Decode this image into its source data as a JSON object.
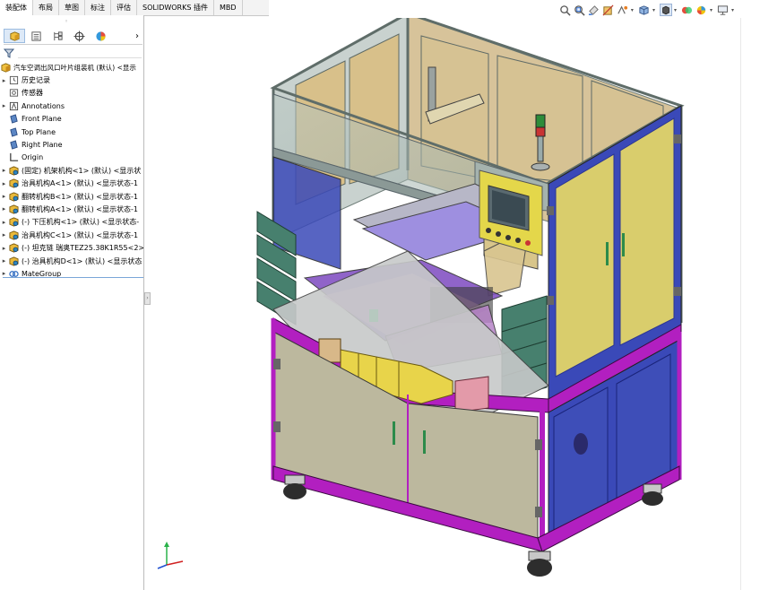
{
  "command_tabs": [
    "装配体",
    "布局",
    "草图",
    "标注",
    "评估",
    "SOLIDWORKS 插件",
    "MBD"
  ],
  "active_tab_index": 0,
  "heads_up_icons": [
    "zoom-to-fit-icon",
    "zoom-area-icon",
    "previous-view-icon",
    "section-view-icon",
    "dynamic-annotation-icon",
    "view-orientation-icon",
    "display-style-icon",
    "hide-show-icon",
    "edit-appearance-icon",
    "apply-scene-icon",
    "view-settings-icon"
  ],
  "panel_tabs": [
    "feature-manager-icon",
    "property-manager-icon",
    "configuration-manager-icon",
    "dimxpert-icon",
    "display-manager-icon"
  ],
  "tree": [
    {
      "label": "汽车空调出风口叶片组装机 (默认) <显示",
      "icon": "assembly",
      "expand": "",
      "root": true
    },
    {
      "label": "历史记录",
      "icon": "history",
      "expand": "▸"
    },
    {
      "label": "传感器",
      "icon": "sensor",
      "expand": ""
    },
    {
      "label": "Annotations",
      "icon": "annotation",
      "expand": "▸"
    },
    {
      "label": "Front Plane",
      "icon": "plane",
      "expand": ""
    },
    {
      "label": "Top Plane",
      "icon": "plane",
      "expand": ""
    },
    {
      "label": "Right Plane",
      "icon": "plane",
      "expand": ""
    },
    {
      "label": "Origin",
      "icon": "origin",
      "expand": ""
    },
    {
      "label": "(固定) 机架机构<1> (默认) <显示状",
      "icon": "subassembly",
      "expand": "▸"
    },
    {
      "label": "治具机构A<1> (默认) <显示状态-1",
      "icon": "subassembly",
      "expand": "▸"
    },
    {
      "label": "翻转机构B<1> (默认) <显示状态-1",
      "icon": "subassembly",
      "expand": "▸"
    },
    {
      "label": "翻转机构A<1> (默认) <显示状态-1",
      "icon": "subassembly",
      "expand": "▸"
    },
    {
      "label": "(-) 下压机构<1> (默认) <显示状态-",
      "icon": "subassembly",
      "expand": "▸"
    },
    {
      "label": "治具机构C<1> (默认) <显示状态-1",
      "icon": "subassembly",
      "expand": "▸"
    },
    {
      "label": "(-) 坦克链 瑞奥TEZ25.38K1R55<2>",
      "icon": "subassembly",
      "expand": "▸"
    },
    {
      "label": "(-) 治具机构D<1> (默认) <显示状态",
      "icon": "subassembly",
      "expand": "▸"
    },
    {
      "label": "MateGroup",
      "icon": "mates",
      "expand": "▸"
    }
  ],
  "colors": {
    "frame_blue": "#3a49b8",
    "frame_magenta": "#b21fc0",
    "panel_khaki": "#bcb89e",
    "door_yellow": "#d9cd6c",
    "guard_gray": "#a9b4b0",
    "bin_green": "#47806e",
    "tray_yellow": "#e8d44a",
    "hmi_yellow": "#e4d74a"
  }
}
